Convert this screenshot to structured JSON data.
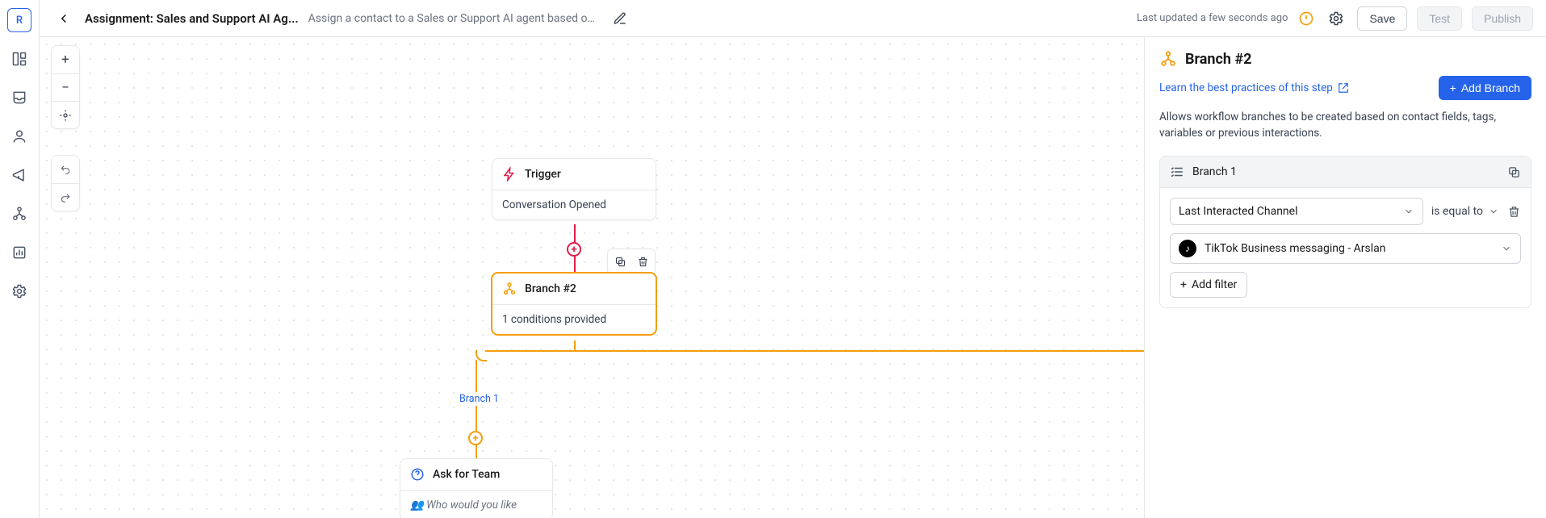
{
  "sidebar": {
    "avatar_letter": "R"
  },
  "header": {
    "title": "Assignment: Sales and Support AI Ag...",
    "subtitle": "Assign a contact to a Sales or Support AI agent based on c...",
    "last_updated": "Last updated a few seconds ago",
    "save_label": "Save",
    "test_label": "Test",
    "publish_label": "Publish"
  },
  "canvas": {
    "trigger": {
      "title": "Trigger",
      "body": "Conversation Opened"
    },
    "branch_node": {
      "title": "Branch #2",
      "body": "1 conditions provided"
    },
    "branch1_label": "Branch 1",
    "ask_node": {
      "title": "Ask for Team",
      "body": "👥 Who would you like"
    }
  },
  "panel": {
    "title": "Branch #2",
    "learn_label": "Learn the best practices of this step",
    "add_branch_label": "Add Branch",
    "description": "Allows workflow branches to be created based on contact fields, tags, variables or previous interactions.",
    "branch": {
      "name": "Branch 1",
      "field": "Last Interacted Channel",
      "operator": "is equal to",
      "value": "TikTok Business messaging - Arslan",
      "add_filter_label": "Add filter"
    }
  }
}
